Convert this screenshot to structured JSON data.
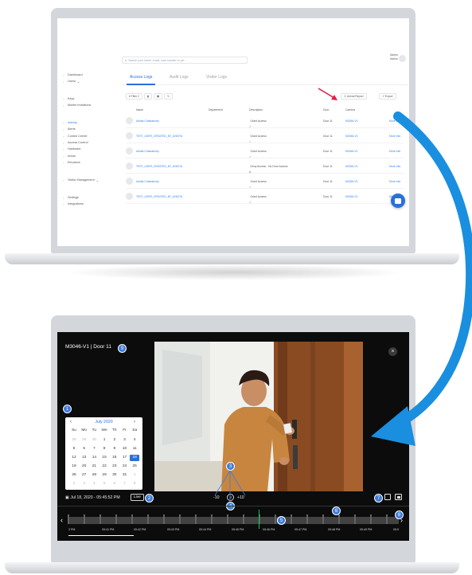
{
  "admin_panel": {
    "search_placeholder": "Search your name, email, card number or pin",
    "admin_name": "Admin",
    "admin_role": "Admin",
    "nav": [
      {
        "label": "Dashboard",
        "icon": "dashboard-icon"
      },
      {
        "label": "Users",
        "icon": "users-icon",
        "caret": "⌄"
      },
      {
        "label": "Keys",
        "icon": "key-icon"
      },
      {
        "label": "Mobile Invitations",
        "icon": "mobile-icon"
      },
      {
        "label": "Activity",
        "icon": "activity-icon",
        "active": true
      },
      {
        "label": "Alerts",
        "icon": "alert-icon"
      },
      {
        "label": "Control Center",
        "icon": "control-center-icon"
      },
      {
        "label": "Access Control",
        "icon": "access-control-icon"
      },
      {
        "label": "Hardware",
        "icon": "hardware-icon"
      },
      {
        "label": "Areas",
        "icon": "areas-icon"
      },
      {
        "label": "Elevators",
        "icon": "elevator-icon"
      },
      {
        "label": "Visitor Management",
        "icon": "visitor-icon",
        "caret": "⌄"
      },
      {
        "label": "Settings",
        "icon": "settings-icon"
      },
      {
        "label": "Integrations",
        "icon": "integrations-icon"
      }
    ],
    "tabs": [
      "Access Logs",
      "Audit Logs",
      "Visitor Logs"
    ],
    "toolbar": {
      "filter": "Filter",
      "filter_count": "2",
      "arrival_report": "Arrival Report",
      "export": "Export"
    },
    "columns": [
      "Name",
      "Department",
      "Description",
      "Door",
      "Camera"
    ],
    "rows": [
      {
        "name": "Ankita Chakraborty",
        "description": "Grant Access",
        "status": "grant",
        "door": "Door 11",
        "camera": "M3046-V1",
        "action": "More Info"
      },
      {
        "name": "TEST_USER_CREATED_BY_ANKITA",
        "description": "Grant Access",
        "status": "grant",
        "door": "Door 11",
        "camera": "M3046-V1",
        "action": "More Info"
      },
      {
        "name": "Ankita Chakraborty",
        "description": "Grant Access",
        "status": "grant",
        "door": "Door 11",
        "camera": "M3046-V1",
        "action": "More Info"
      },
      {
        "name": "TEST_USER_CREATED_BY_ANKITA",
        "description": "Deny Access - No Door Access",
        "status": "deny",
        "door": "Door 11",
        "camera": "M3046-V1",
        "action": "More Info"
      },
      {
        "name": "Ankita Chakraborty",
        "description": "Grant Access",
        "status": "grant",
        "door": "Door 11",
        "camera": "M3046-V1",
        "action": "More Info"
      },
      {
        "name": "TEST_USER_CREATED_BY_ANKITA",
        "description": "Grant Access",
        "status": "grant",
        "door": "Door 11",
        "camera": "M3046-V1",
        "action": "More Info"
      }
    ],
    "glyphs": {
      "check": "✓",
      "deny": "●",
      "search": "⌕",
      "arrow_left": "‹",
      "arrow_right": "›"
    }
  },
  "video_panel": {
    "title": "M3046-V1 | Door 11",
    "close": "×",
    "calendar": {
      "prev": "‹",
      "next": "›",
      "month": "July 2020",
      "weekdays": [
        "Su",
        "Mo",
        "Tu",
        "We",
        "Th",
        "Fr",
        "Sa"
      ],
      "weeks": [
        [
          "28",
          "29",
          "30",
          "1",
          "2",
          "3",
          "4"
        ],
        [
          "5",
          "6",
          "7",
          "8",
          "9",
          "10",
          "11"
        ],
        [
          "12",
          "13",
          "14",
          "15",
          "16",
          "17",
          "18"
        ],
        [
          "19",
          "20",
          "21",
          "22",
          "23",
          "24",
          "25"
        ],
        [
          "26",
          "27",
          "28",
          "29",
          "30",
          "31",
          "1"
        ],
        [
          "2",
          "3",
          "4",
          "5",
          "6",
          "7",
          "8"
        ]
      ],
      "selected": "18"
    },
    "datetime": "Jul 18, 2020 - 05:45:52 PM",
    "live": "Live",
    "skip_back": "-10",
    "skip_forward": "+10",
    "pause_glyph": "II",
    "timeline_labels": [
      "3 PM",
      "05:41 PM",
      "05:42 PM",
      "05:43 PM",
      "05:44 PM",
      "05:45 PM",
      "05:46 PM",
      "05:47 PM",
      "05:48 PM",
      "05:49 PM",
      "05:5"
    ],
    "badges": [
      "1",
      "2",
      "3",
      "4",
      "5",
      "6",
      "7",
      "8",
      "9"
    ]
  },
  "colors": {
    "accent": "#2b6fd8",
    "arrow": "#1a8fe0",
    "live_marker": "#19c25a",
    "deny": "#e11d48",
    "grant": "#22a06b"
  }
}
